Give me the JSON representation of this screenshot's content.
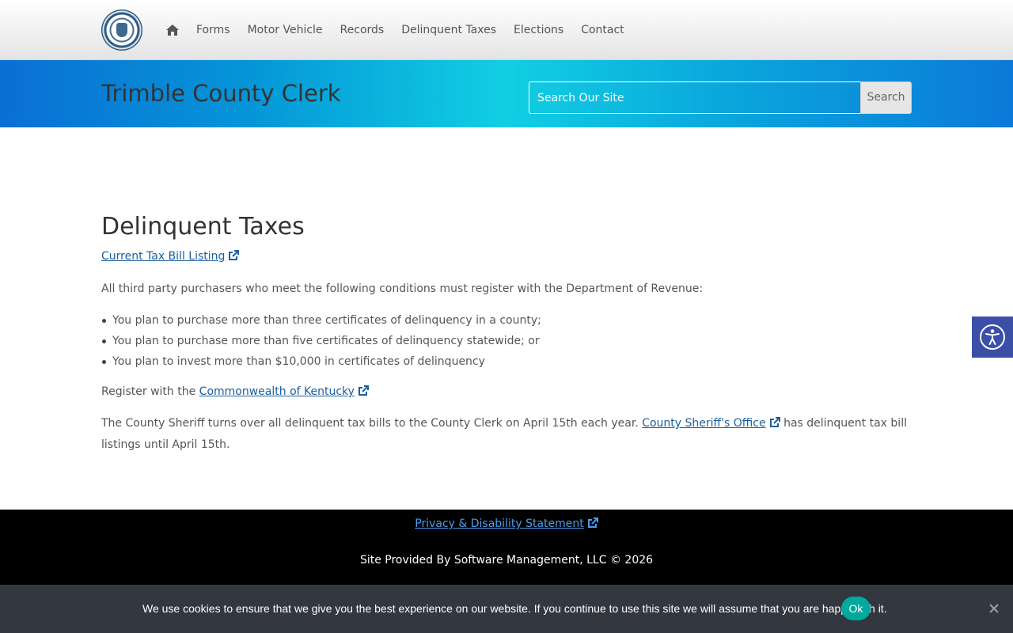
{
  "nav": {
    "logo_icon": "county-clerk-seal",
    "home_icon": "home-icon",
    "items": [
      "Forms",
      "Motor Vehicle",
      "Records",
      "Delinquent Taxes",
      "Elections",
      "Contact"
    ]
  },
  "banner": {
    "title": "Trimble County Clerk",
    "search_placeholder": "Search Our Site",
    "search_button": "Search"
  },
  "main": {
    "title": "Delinquent Taxes",
    "tax_bill_link": "Current Tax Bill Listing",
    "intro": "All third party purchasers who meet the following conditions must register with the Department of Revenue:",
    "conditions": [
      "You plan to purchase more than three certificates of delinquency in a county;",
      "You plan to purchase more than five certificates of delinquency statewide; or",
      "You plan to invest more than $10,000 in certificates of delinquency"
    ],
    "register_prefix": "Register with the ",
    "register_link": "Commonwealth of Kentucky",
    "sheriff_prefix": "The County Sheriff turns over all delinquent tax bills to the County Clerk on April 15th each year. ",
    "sheriff_link": "County Sheriff's Office",
    "sheriff_suffix": " has delinquent tax bill listings until April 15th."
  },
  "footer": {
    "privacy_link": "Privacy & Disability Statement",
    "credit": "Site Provided By Software Management, LLC © 2026"
  },
  "cookie": {
    "message": "We use cookies to ensure that we give you the best experience on our website. If you continue to use this site we will assume that you are happy with it.",
    "ok": "Ok"
  },
  "colors": {
    "link": "#1a5fa0",
    "banner_blue": "#0a6fd4",
    "banner_cyan": "#11cfe2",
    "cookie_ok": "#00a99d",
    "a11y": "#3b4fa8"
  }
}
